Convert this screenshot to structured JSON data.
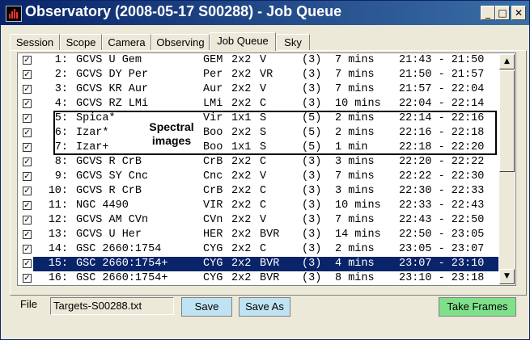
{
  "window": {
    "title": "Observatory (2008-05-17 S00288) - Job Queue",
    "minimize": "_",
    "maximize": "□",
    "close": "✕"
  },
  "tabs": [
    {
      "label": "Session"
    },
    {
      "label": "Scope"
    },
    {
      "label": "Camera"
    },
    {
      "label": "Observing"
    },
    {
      "label": "Job Queue",
      "active": true
    },
    {
      "label": "Sky"
    }
  ],
  "jobs": [
    {
      "checked": true,
      "num": "1:",
      "name": "GCVS U Gem",
      "con": "GEM",
      "bin": "2x2",
      "filter": "V",
      "priority": "(3)",
      "duration": "7 mins",
      "time": "21:43 - 21:50"
    },
    {
      "checked": true,
      "num": "2:",
      "name": "GCVS DY Per",
      "con": "Per",
      "bin": "2x2",
      "filter": "VR",
      "priority": "(3)",
      "duration": "7 mins",
      "time": "21:50 - 21:57"
    },
    {
      "checked": true,
      "num": "3:",
      "name": "GCVS KR Aur",
      "con": "Aur",
      "bin": "2x2",
      "filter": "V",
      "priority": "(3)",
      "duration": "7 mins",
      "time": "21:57 - 22:04"
    },
    {
      "checked": true,
      "num": "4:",
      "name": "GCVS RZ LMi",
      "con": "LMi",
      "bin": "2x2",
      "filter": "C",
      "priority": "(3)",
      "duration": "10 mins",
      "time": "22:04 - 22:14"
    },
    {
      "checked": true,
      "num": "5:",
      "name": "Spica*",
      "con": "Vir",
      "bin": "1x1",
      "filter": "S",
      "priority": "(5)",
      "duration": "2 mins",
      "time": "22:14 - 22:16"
    },
    {
      "checked": true,
      "num": "6:",
      "name": "Izar*",
      "con": "Boo",
      "bin": "2x2",
      "filter": "S",
      "priority": "(5)",
      "duration": "2 mins",
      "time": "22:16 - 22:18"
    },
    {
      "checked": true,
      "num": "7:",
      "name": "Izar+",
      "con": "Boo",
      "bin": "1x1",
      "filter": "S",
      "priority": "(5)",
      "duration": "1 min",
      "time": "22:18 - 22:20"
    },
    {
      "checked": true,
      "num": "8:",
      "name": "GCVS R CrB",
      "con": "CrB",
      "bin": "2x2",
      "filter": "C",
      "priority": "(3)",
      "duration": "3 mins",
      "time": "22:20 - 22:22"
    },
    {
      "checked": true,
      "num": "9:",
      "name": "GCVS SY Cnc",
      "con": "Cnc",
      "bin": "2x2",
      "filter": "V",
      "priority": "(3)",
      "duration": "7 mins",
      "time": "22:22 - 22:30"
    },
    {
      "checked": true,
      "num": "10:",
      "name": "GCVS R CrB",
      "con": "CrB",
      "bin": "2x2",
      "filter": "C",
      "priority": "(3)",
      "duration": "3 mins",
      "time": "22:30 - 22:33"
    },
    {
      "checked": true,
      "num": "11:",
      "name": "NGC 4490",
      "con": "VIR",
      "bin": "2x2",
      "filter": "C",
      "priority": "(3)",
      "duration": "10 mins",
      "time": "22:33 - 22:43"
    },
    {
      "checked": true,
      "num": "12:",
      "name": "GCVS AM CVn",
      "con": "CVn",
      "bin": "2x2",
      "filter": "V",
      "priority": "(3)",
      "duration": "7 mins",
      "time": "22:43 - 22:50"
    },
    {
      "checked": true,
      "num": "13:",
      "name": "GCVS U Her",
      "con": "HER",
      "bin": "2x2",
      "filter": "BVR",
      "priority": "(3)",
      "duration": "14 mins",
      "time": "22:50 - 23:05"
    },
    {
      "checked": true,
      "num": "14:",
      "name": "GSC 2660:1754",
      "con": "CYG",
      "bin": "2x2",
      "filter": "C",
      "priority": "(3)",
      "duration": "2 mins",
      "time": "23:05 - 23:07"
    },
    {
      "checked": true,
      "num": "15:",
      "name": "GSC 2660:1754+",
      "con": "CYG",
      "bin": "2x2",
      "filter": "BVR",
      "priority": "(3)",
      "duration": "4 mins",
      "time": "23:07 - 23:10",
      "selected": true
    },
    {
      "checked": true,
      "num": "16:",
      "name": "GSC 2660:1754+",
      "con": "CYG",
      "bin": "2x2",
      "filter": "BVR",
      "priority": "(3)",
      "duration": "8 mins",
      "time": "23:10 - 23:18"
    }
  ],
  "annotation": {
    "line1": "Spectral",
    "line2": "images"
  },
  "scrollbar": {
    "up_glyph": "▲",
    "down_glyph": "▼"
  },
  "file": {
    "label": "File",
    "value": "Targets-S00288.txt"
  },
  "buttons": {
    "save": "Save",
    "save_as": "Save As",
    "take_frames": "Take Frames"
  },
  "colors": {
    "selection": "#0a246a",
    "save_button": "#bfe3f2",
    "take_frames_button": "#7fe08a"
  }
}
